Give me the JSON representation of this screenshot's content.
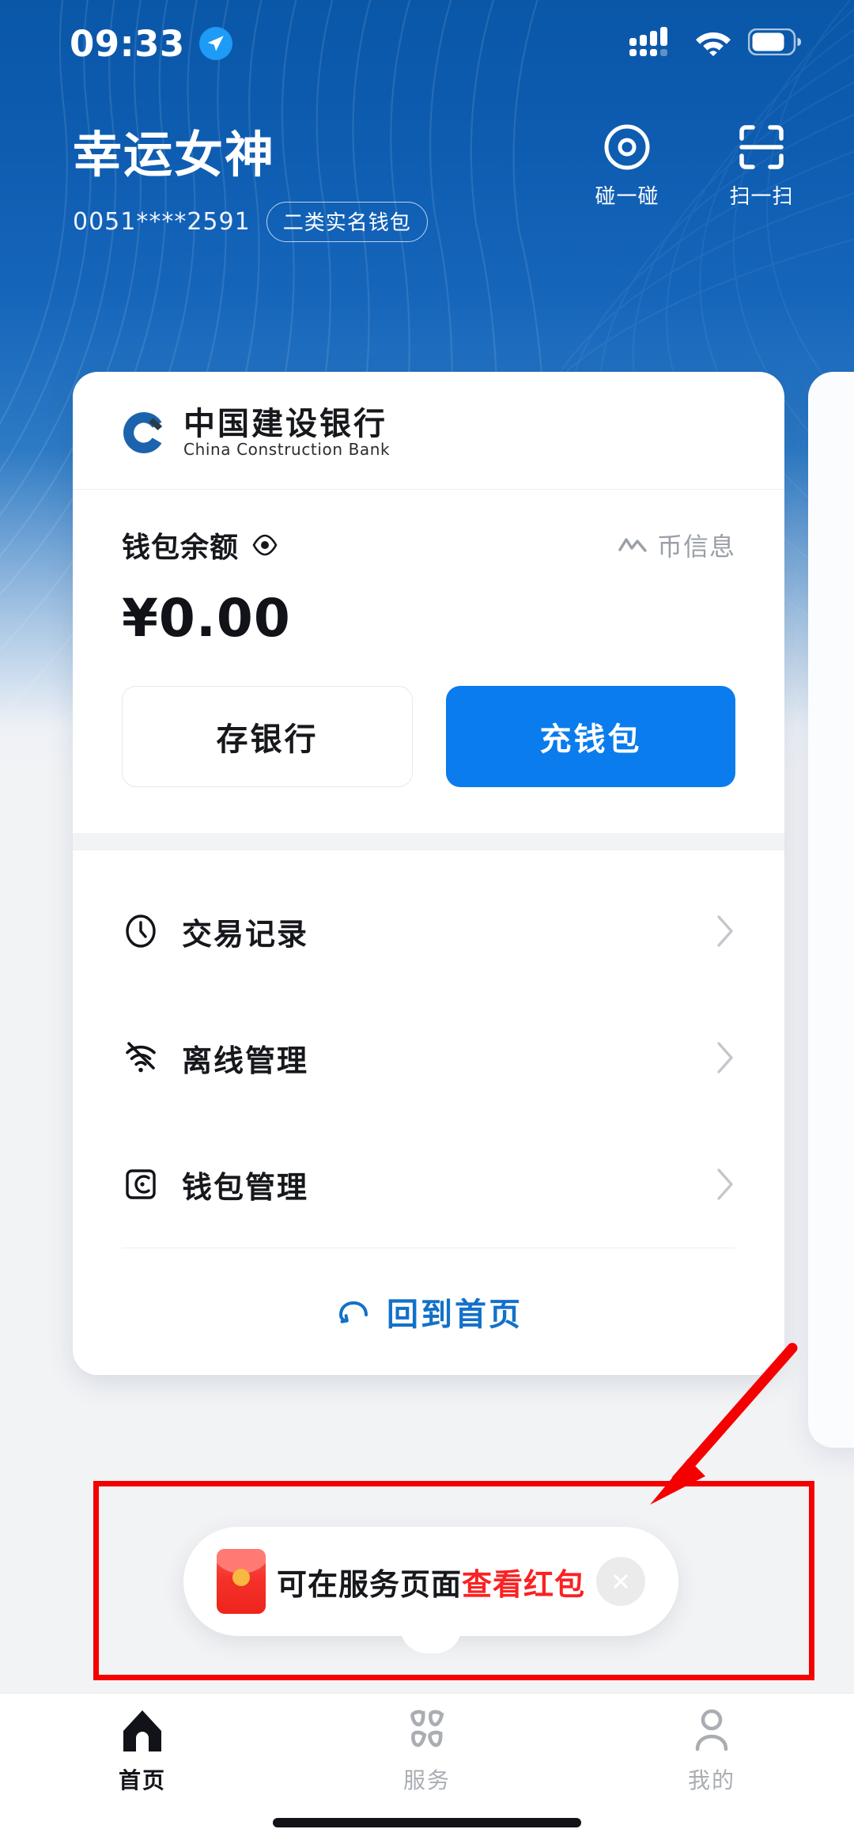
{
  "status_bar": {
    "time": "09:33",
    "location_icon": "location-arrow-icon",
    "signal_icon": "cellular-signal-icon",
    "wifi_icon": "wifi-icon",
    "battery_icon": "battery-icon"
  },
  "header": {
    "title": "幸运女神",
    "account_number": "0051****2591",
    "account_badge": "二类实名钱包",
    "actions": [
      {
        "label": "碰一碰",
        "icon": "nfc-tap-icon"
      },
      {
        "label": "扫一扫",
        "icon": "scan-icon"
      }
    ]
  },
  "wallet_card": {
    "bank_name_cn": "中国建设银行",
    "bank_name_en": "China Construction Bank",
    "bank_logo_icon": "ccb-logo-icon",
    "balance_label": "钱包余额",
    "balance_eye_icon": "eye-icon",
    "coin_info_label": "币信息",
    "coin_info_icon": "trend-line-icon",
    "balance_amount": "¥0.00",
    "buttons": [
      {
        "label": "存银行",
        "style": "ghost"
      },
      {
        "label": "充钱包",
        "style": "solid"
      }
    ],
    "menu": [
      {
        "label": "交易记录",
        "icon": "clock-icon"
      },
      {
        "label": "离线管理",
        "icon": "wifi-off-icon"
      },
      {
        "label": "钱包管理",
        "icon": "wallet-icon"
      }
    ],
    "home_link": {
      "label": "回到首页",
      "icon": "return-arrow-icon"
    }
  },
  "toast": {
    "icon": "red-envelope-icon",
    "text_normal": "可在服务页面",
    "text_highlight": "查看红包",
    "close_icon": "close-icon",
    "highlight_color": "#fa2222"
  },
  "annotations": {
    "highlight_rect_color": "#f40000",
    "arrow_color": "#f40000"
  },
  "tabbar": {
    "items": [
      {
        "label": "首页",
        "icon": "home-icon",
        "active": true
      },
      {
        "label": "服务",
        "icon": "grid-icon",
        "active": false
      },
      {
        "label": "我的",
        "icon": "person-icon",
        "active": false
      }
    ]
  },
  "colors": {
    "brand_blue": "#0a57a8",
    "accent_blue": "#0a7ced",
    "link_blue": "#1271c9"
  }
}
